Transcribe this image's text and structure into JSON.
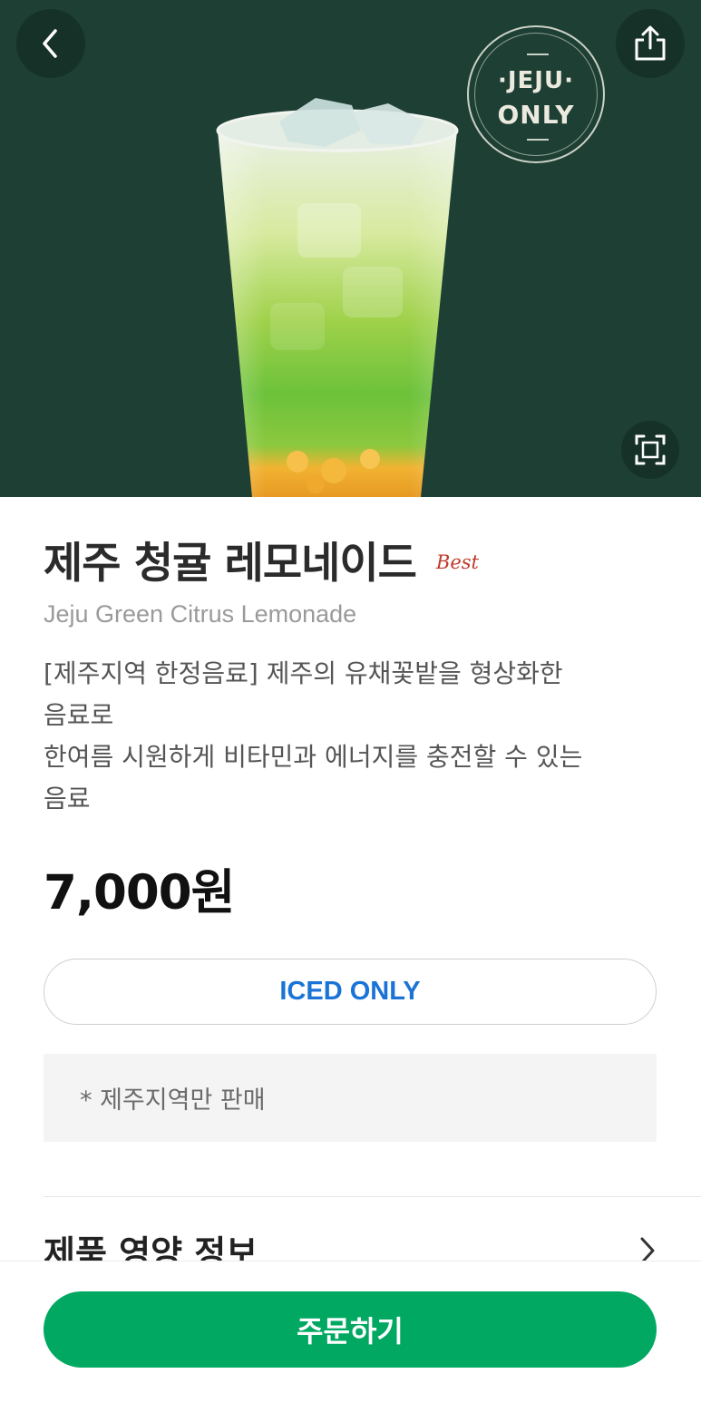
{
  "hero": {
    "badge_line1": "·JEJU·",
    "badge_line2": "ONLY",
    "background_color": "#1d3f34",
    "back_icon": "chevron-left-icon",
    "share_icon": "share-icon",
    "zoom_icon": "fullscreen-icon"
  },
  "product": {
    "name_ko": "제주 청귤 레모네이드",
    "best_label": "Best",
    "name_en": "Jeju Green Citrus Lemonade",
    "description_line1": "[제주지역 한정음료] 제주의 유채꽃밭을 형상화한",
    "description_line2": "음료로",
    "description_line3": "한여름 시원하게 비타민과 에너지를 충전할 수 있는",
    "description_line4": "음료",
    "price": "7,000원",
    "temperature": "ICED ONLY",
    "notice": "* 제주지역만 판매"
  },
  "sections": {
    "nutrition_label": "제품 영양 정보"
  },
  "actions": {
    "order_label": "주문하기",
    "order_color": "#00a862",
    "temp_color": "#1a73d6"
  }
}
